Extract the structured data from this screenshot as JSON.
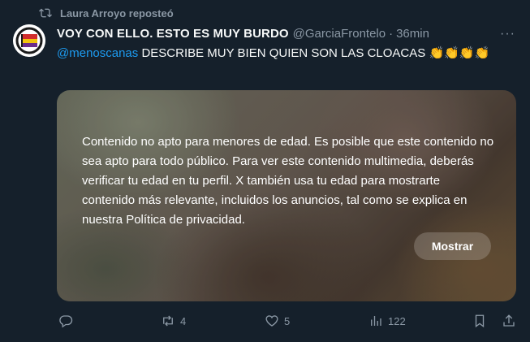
{
  "repost": {
    "label": "Laura Arroyo reposteó",
    "icon": "repost-icon"
  },
  "author": {
    "display_name": "VOY CON ELLO. ESTO ES MUY BURDO",
    "handle": "@GarciaFrontelo",
    "separator": "·",
    "time": "36min",
    "avatar_icon": "antifascist-flag-avatar"
  },
  "more_label": "···",
  "tweet": {
    "mention": "@menoscanas",
    "text": " DESCRIBE MUY BIEN QUIEN SON LAS CLOACAS ",
    "emojis": "👏👏👏👏"
  },
  "media": {
    "warning": "Contenido no apto para menores de edad. Es posible que este contenido no sea apto para todo público. Para ver este contenido multimedia, deberás verificar tu edad en tu perfil. X también usa tu edad para mostrarte contenido más relevante, incluidos los anuncios, tal como se explica en nuestra Política de privacidad.",
    "show_button": "Mostrar"
  },
  "actions": {
    "replies": "",
    "reposts": "4",
    "likes": "5",
    "views": "122"
  },
  "colors": {
    "background": "#15202b",
    "accent": "#1d9bf0",
    "muted": "#8b98a5"
  }
}
